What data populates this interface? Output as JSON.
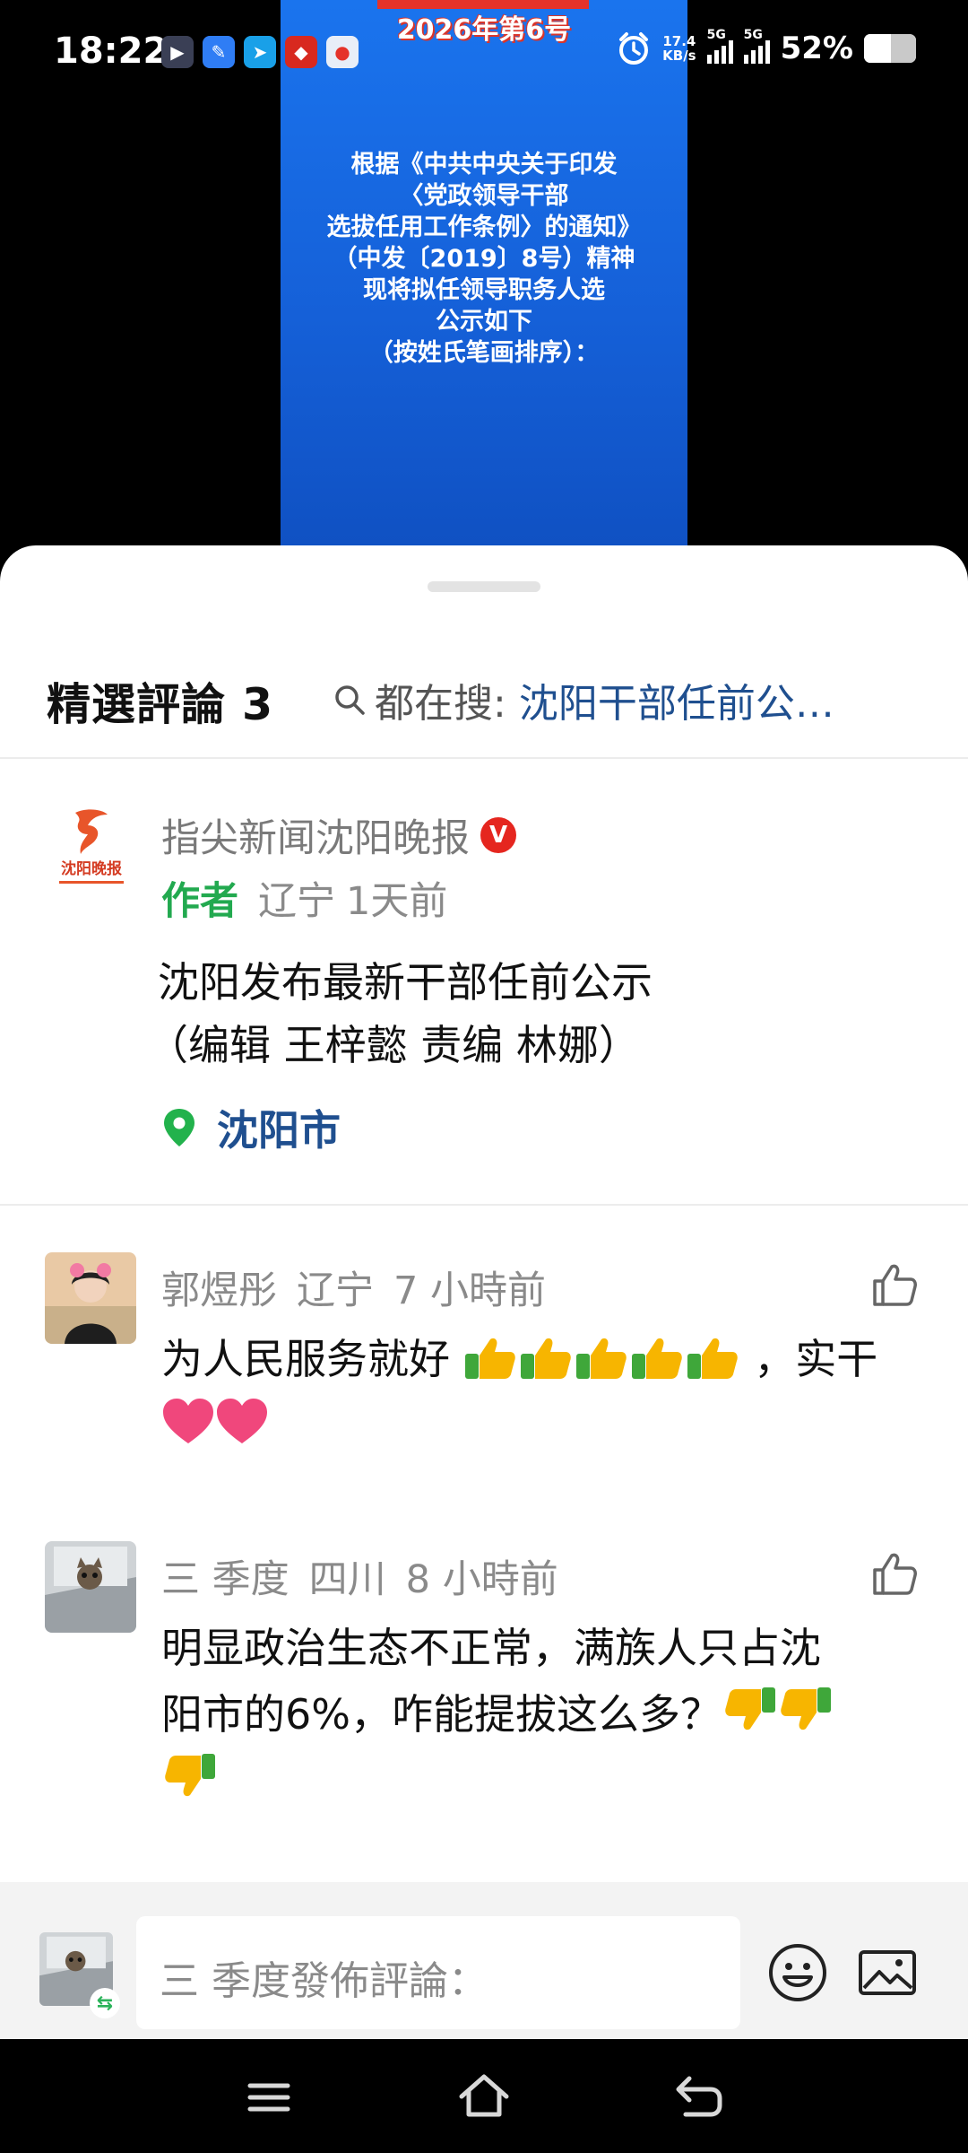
{
  "status": {
    "time": "18:22",
    "net_speed_value": "17.4",
    "net_speed_unit": "KB/s",
    "network_1": "5G",
    "network_2": "5G",
    "battery_percent": "52%",
    "battery_level": 0.52
  },
  "video": {
    "issue": "2026年第6号",
    "lines": [
      "根据《中共中央关于印发",
      "〈党政领导干部",
      "选拔任用工作条例〉的通知》",
      "（中发〔2019〕8号）精神",
      "现将拟任领导职务人选",
      "公示如下",
      "（按姓氏笔画排序）："
    ]
  },
  "sheet": {
    "title": "精選評論 3",
    "search_label": "都在搜:",
    "search_keyword": "沈阳干部任前公…"
  },
  "author_post": {
    "name": "指尖新闻沈阳晚报",
    "verified_badge": "V",
    "logo_text": "沈阳晚报",
    "tag": "作者",
    "region": "辽宁",
    "time": "1天前",
    "text_lines": [
      "沈阳发布最新干部任前公示",
      "（编辑 王梓懿 责编 林娜）"
    ],
    "location": "沈阳市"
  },
  "comments": [
    {
      "user": "郭煜彤",
      "region": "辽宁",
      "time": "7 小時前",
      "line1_text": "为人民服务就好",
      "line1_suffix": "，实干",
      "emoji_1": "thumbs-up",
      "emoji_2": "heart"
    },
    {
      "user": "三 季度",
      "region": "四川",
      "time": "8 小時前",
      "line1": "明显政治生态不正常，满族人只占沈",
      "line2": "阳市的6%，咋能提拔这么多？",
      "emoji_1": "thumbs-down"
    }
  ],
  "compose": {
    "placeholder": "三 季度發佈評論："
  },
  "icons": {
    "search": "search-icon",
    "location": "location-pin-icon",
    "like": "thumbs-up-outline-icon",
    "emoji": "smiley-icon",
    "image": "image-icon",
    "nav_menu": "menu-icon",
    "nav_home": "home-icon",
    "nav_back": "back-icon"
  },
  "colors": {
    "author_tag": "#22a94f",
    "link_blue": "#1f4f8f",
    "verified_red": "#e5261f",
    "video_blue": "#1a74ee"
  }
}
